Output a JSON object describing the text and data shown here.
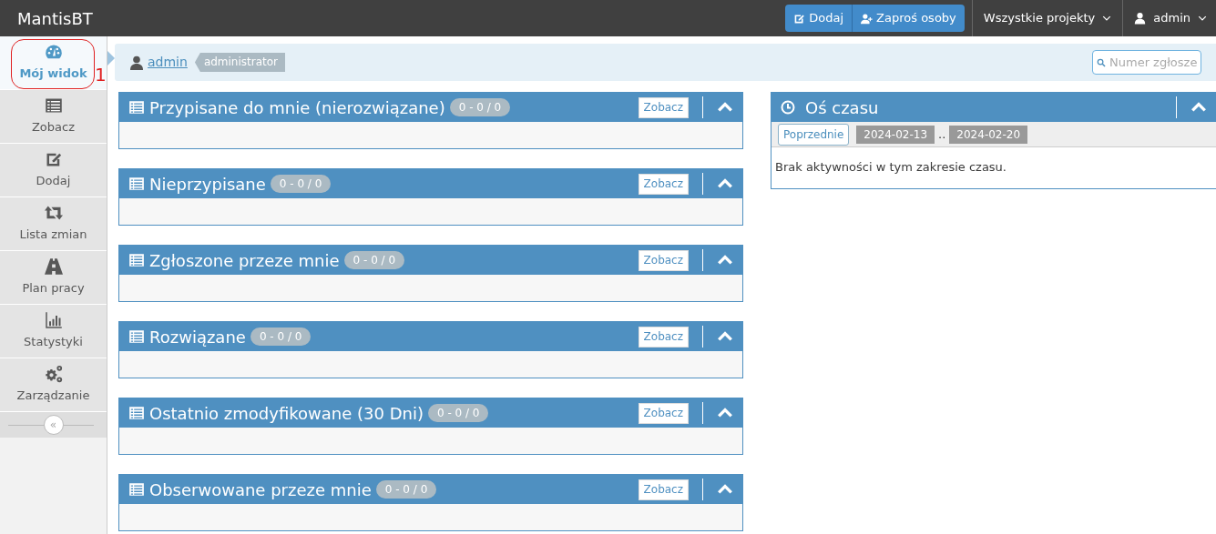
{
  "navbar": {
    "brand": "MantisBT",
    "buttons": [
      {
        "label": "Dodaj",
        "kind": "edit"
      },
      {
        "label": "Zaproś osoby",
        "kind": "invite"
      }
    ],
    "project_menu": "Wszystkie projekty",
    "user_menu": "admin"
  },
  "sidebar": {
    "items": [
      {
        "label": "Mój widok",
        "kind": "dashboard",
        "selected": true
      },
      {
        "label": "Zobacz",
        "kind": "list",
        "selected": false
      },
      {
        "label": "Dodaj",
        "kind": "edit",
        "selected": false
      },
      {
        "label": "Lista zmian",
        "kind": "changelog",
        "selected": false
      },
      {
        "label": "Plan pracy",
        "kind": "roadmap",
        "selected": false
      },
      {
        "label": "Statystyki",
        "kind": "stats",
        "selected": false
      },
      {
        "label": "Zarządzanie",
        "kind": "manage",
        "selected": false
      }
    ],
    "collapse_button": "«"
  },
  "annotation": {
    "label": "1"
  },
  "breadcrumb": {
    "user": "admin",
    "role": "administrator",
    "search_placeholder": "Numer zgłosze"
  },
  "widgets": [
    {
      "title": "Przypisane do mnie (nierozwiązane)",
      "count": "0 - 0 / 0",
      "button": "Zobacz",
      "expanded": true
    },
    {
      "title": "Nieprzypisane",
      "count": "0 - 0 / 0",
      "button": "Zobacz",
      "expanded": true
    },
    {
      "title": "Zgłoszone przeze mnie",
      "count": "0 - 0 / 0",
      "button": "Zobacz",
      "expanded": true
    },
    {
      "title": "Rozwiązane",
      "count": "0 - 0 / 0",
      "button": "Zobacz",
      "expanded": true
    },
    {
      "title": "Ostatnio zmodyfikowane (30 Dni)",
      "count": "0 - 0 / 0",
      "button": "Zobacz",
      "expanded": true
    },
    {
      "title": "Obserwowane przeze mnie",
      "count": "0 - 0 / 0",
      "button": "Zobacz",
      "expanded": true
    }
  ],
  "timeline": {
    "title": "Oś czasu",
    "expanded": true,
    "prev_button": "Poprzednie",
    "date_from": "2024-02-13",
    "separator": "..",
    "date_to": "2024-02-20",
    "message": "Brak aktywności w tym zakresie czasu."
  }
}
